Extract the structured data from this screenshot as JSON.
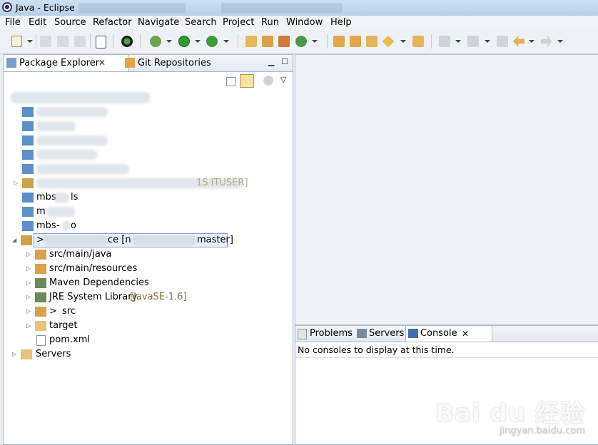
{
  "window": {
    "title": "Java - Eclipse"
  },
  "menu": [
    "File",
    "Edit",
    "Source",
    "Refactor",
    "Navigate",
    "Search",
    "Project",
    "Run",
    "Window",
    "Help"
  ],
  "left_tabs": {
    "package_explorer": "Package Explorer",
    "git_repositories": "Git Repositories"
  },
  "tree": {
    "mbs_1": "mbs",
    "mbs_1_suffix": "ls",
    "mbs_2": "m",
    "mbs_3": "mbs-",
    "mbs_3_suffix": "o",
    "project_prefix": ">",
    "project_name_tail": "ce [n",
    "project_branch_tail": "master]",
    "faded_suffix": "1S ITUSER]",
    "items": {
      "src_main_java": "src/main/java",
      "src_main_resources": "src/main/resources",
      "maven_deps": "Maven Dependencies",
      "jre_lib": "JRE System Library",
      "jre_version": "[JavaSE-1.6]",
      "src_prefix": ">",
      "src": "src",
      "target": "target",
      "pom": "pom.xml"
    },
    "servers": "Servers"
  },
  "bottom_tabs": {
    "problems": "Problems",
    "servers": "Servers",
    "console": "Console"
  },
  "console": {
    "message": "No consoles to display at this time."
  },
  "watermark": {
    "main": "Bai du 经验",
    "sub": "jingyan.baidu.com"
  }
}
